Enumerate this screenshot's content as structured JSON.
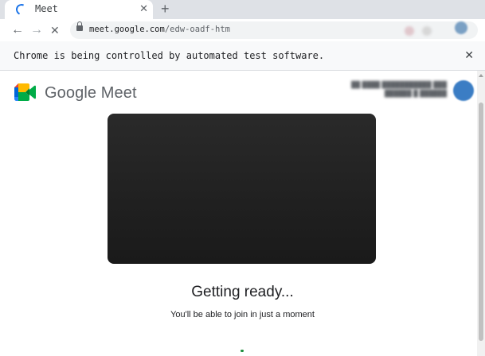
{
  "browser": {
    "tab_title": "Meet",
    "tab_close": "✕",
    "new_tab": "+",
    "back": "←",
    "forward": "→",
    "stop": "✕",
    "url_host": "meet.google.com",
    "url_path": "/edw-oadf-htm"
  },
  "infobar": {
    "message": "Chrome is being controlled by automated test software.",
    "close": "✕"
  },
  "page": {
    "brand": "Google Meet",
    "heading": "Getting ready...",
    "subtext": "You'll be able to join in just a moment"
  },
  "colors": {
    "meet_green": "#00832d",
    "meet_blue": "#0066da",
    "meet_red": "#e94235",
    "meet_yellow": "#ffba00",
    "chrome_blue": "#1a73e8"
  },
  "icons": [
    "loading-spinner-icon",
    "lock-icon",
    "back-arrow-icon",
    "forward-arrow-icon",
    "stop-icon",
    "close-icon",
    "meet-logo-icon"
  ]
}
